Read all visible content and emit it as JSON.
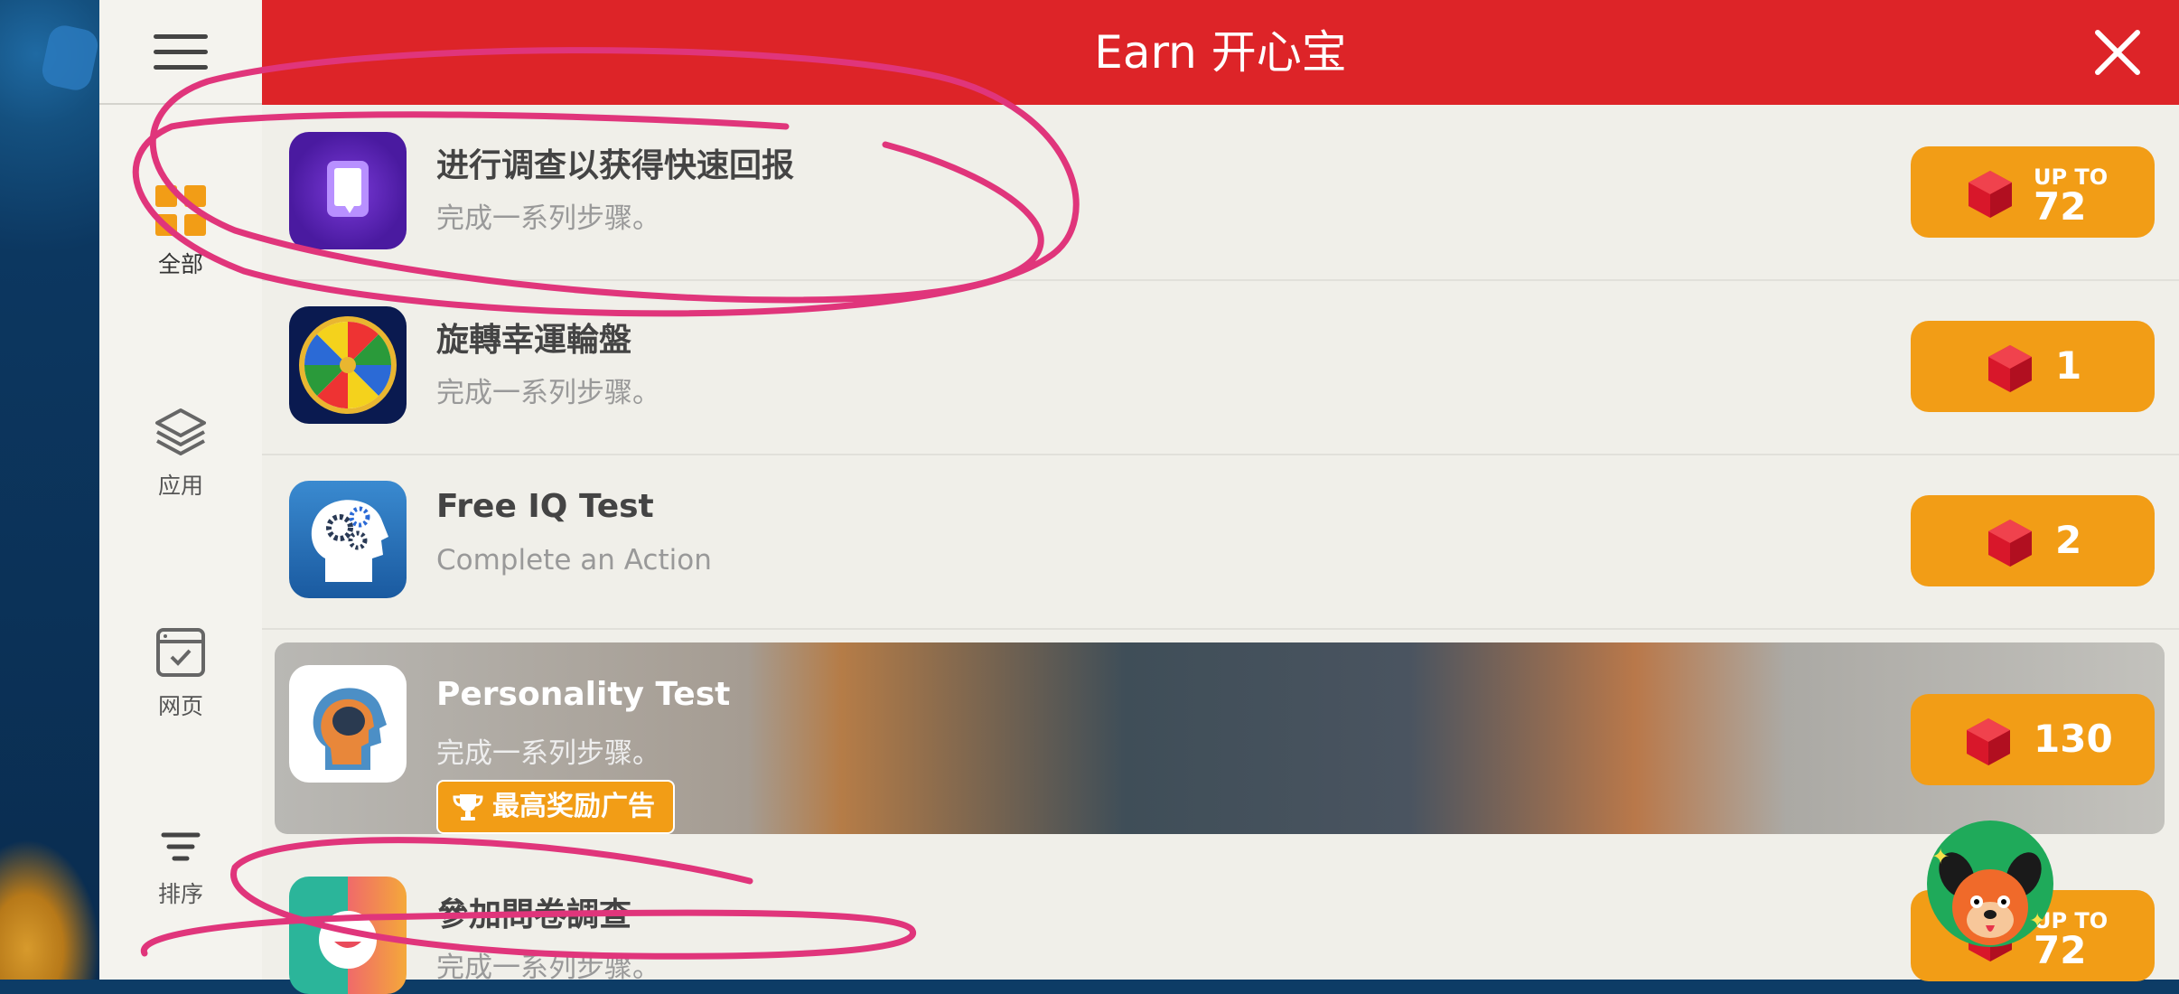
{
  "header": {
    "title": "Earn 开心宝"
  },
  "sidebar": {
    "items": [
      {
        "label": "全部",
        "icon": "grid-icon",
        "active": true
      },
      {
        "label": "应用",
        "icon": "layers-icon"
      },
      {
        "label": "网页",
        "icon": "webpage-icon"
      },
      {
        "label": "排序",
        "icon": "sort-icon"
      }
    ]
  },
  "offers": [
    {
      "title": "进行调查以获得快速回报",
      "subtitle": "完成一系列步骤。",
      "reward_prefix": "UP TO",
      "reward": "72",
      "icon": "survey-icon"
    },
    {
      "title": "旋轉幸運輪盤",
      "subtitle": "完成一系列步骤。",
      "reward": "1",
      "icon": "wheel-icon"
    },
    {
      "title": "Free IQ Test",
      "subtitle": "Complete an Action",
      "reward": "2",
      "icon": "brain-gears-icon"
    },
    {
      "title": "Personality Test",
      "subtitle": "完成一系列步骤。",
      "badge": "最高奖励广告",
      "reward": "130",
      "icon": "head-profile-icon"
    },
    {
      "title": "參加問卷調查",
      "subtitle": "完成一系列步骤。",
      "reward_prefix": "UP TO",
      "reward": "72",
      "icon": "chat-face-icon"
    }
  ],
  "colors": {
    "header": "#dd2428",
    "reward": "#f29d16",
    "annotation": "#e0357b"
  }
}
